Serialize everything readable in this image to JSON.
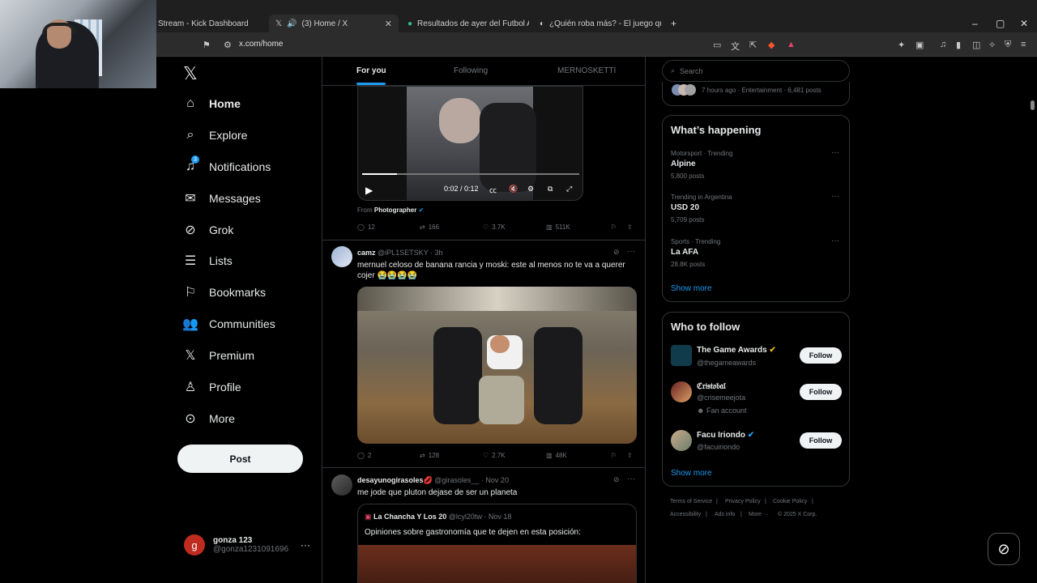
{
  "browser": {
    "tabs": [
      {
        "label": "Stream - Kick Dashboard",
        "active": false
      },
      {
        "label": "(3) Home / X",
        "active": true
      },
      {
        "label": "Resultados de ayer del Futbol Argent",
        "active": false
      },
      {
        "label": "¿Quién roba más? - El juego que nad",
        "active": false
      }
    ],
    "url": "x.com/home"
  },
  "nav": {
    "items": [
      {
        "label": "Home",
        "icon": "home-icon"
      },
      {
        "label": "Explore",
        "icon": "search-icon"
      },
      {
        "label": "Notifications",
        "icon": "bell-icon",
        "badge": "3"
      },
      {
        "label": "Messages",
        "icon": "envelope-icon"
      },
      {
        "label": "Grok",
        "icon": "grok-icon"
      },
      {
        "label": "Lists",
        "icon": "list-icon"
      },
      {
        "label": "Bookmarks",
        "icon": "bookmark-icon"
      },
      {
        "label": "Communities",
        "icon": "people-icon"
      },
      {
        "label": "Premium",
        "icon": "x-logo-icon"
      },
      {
        "label": "Profile",
        "icon": "person-icon"
      },
      {
        "label": "More",
        "icon": "more-circle-icon"
      }
    ],
    "post_label": "Post",
    "user": {
      "avatar_letter": "g",
      "name": "gonza 123",
      "handle": "@gonza1231091696"
    }
  },
  "feed": {
    "tabs": [
      "For you",
      "Following",
      "MERNOSKETTI"
    ],
    "video_post": {
      "time": "0:02 / 0:12",
      "progress": 0.16,
      "from_label": "From",
      "from_name": "Photographer",
      "replies": "12",
      "reposts": "166",
      "likes": "3.7K",
      "views": "511K"
    },
    "post2": {
      "name": "camz",
      "handle": "@iPL1SETSKY · 3h",
      "text": "mernuel celoso de banana rancia y moski: este al menos no te va a querer cojer 😭😭😭😭",
      "replies": "2",
      "reposts": "128",
      "likes": "2.7K",
      "views": "48K"
    },
    "post3": {
      "name": "desayunogirasoles💋",
      "handle": "@girasoles__ · Nov 20",
      "text": "me jode que pluton dejase de ser un planeta",
      "quote_name": "La Chancha Y Los 20",
      "quote_handle": "@lcyl20tw · Nov 18",
      "quote_text": "Opiniones sobre gastronomía que te dejen en esta posición:"
    }
  },
  "sidebar": {
    "search_placeholder": "Search",
    "top_trend_meta": "7 hours ago · Entertainment · 6,481 posts",
    "happening_title": "What’s happening",
    "trends": [
      {
        "category": "Motorsport · Trending",
        "name": "Alpine",
        "posts": "5,800 posts"
      },
      {
        "category": "Trending in Argentina",
        "name": "USD 20",
        "posts": "5,709 posts"
      },
      {
        "category": "Sports · Trending",
        "name": "La AFA",
        "posts": "28.8K posts"
      }
    ],
    "show_more": "Show more",
    "follow_title": "Who to follow",
    "follow": [
      {
        "name": "The Game Awards",
        "handle": "@thegameawards",
        "extra": "",
        "btn": "Follow"
      },
      {
        "name": "ℭ𝔯𝔦𝔰𝔱𝔬𝔟𝔞𝔩",
        "handle": "@crisemeejota",
        "extra": "Fan account",
        "btn": "Follow"
      },
      {
        "name": "Facu Iriondo",
        "handle": "@facuiriondo",
        "extra": "",
        "btn": "Follow"
      }
    ],
    "footer": [
      "Terms of Service",
      "|",
      "Privacy Policy",
      "|",
      "Cookie Policy",
      "|",
      "Accessibility",
      "|",
      "Ads info",
      "|",
      "More ···",
      "© 2025 X Corp."
    ]
  },
  "colors": {
    "accent": "#1d9bf0",
    "bg": "#000000",
    "border": "#2f3336",
    "muted": "#71767b"
  }
}
